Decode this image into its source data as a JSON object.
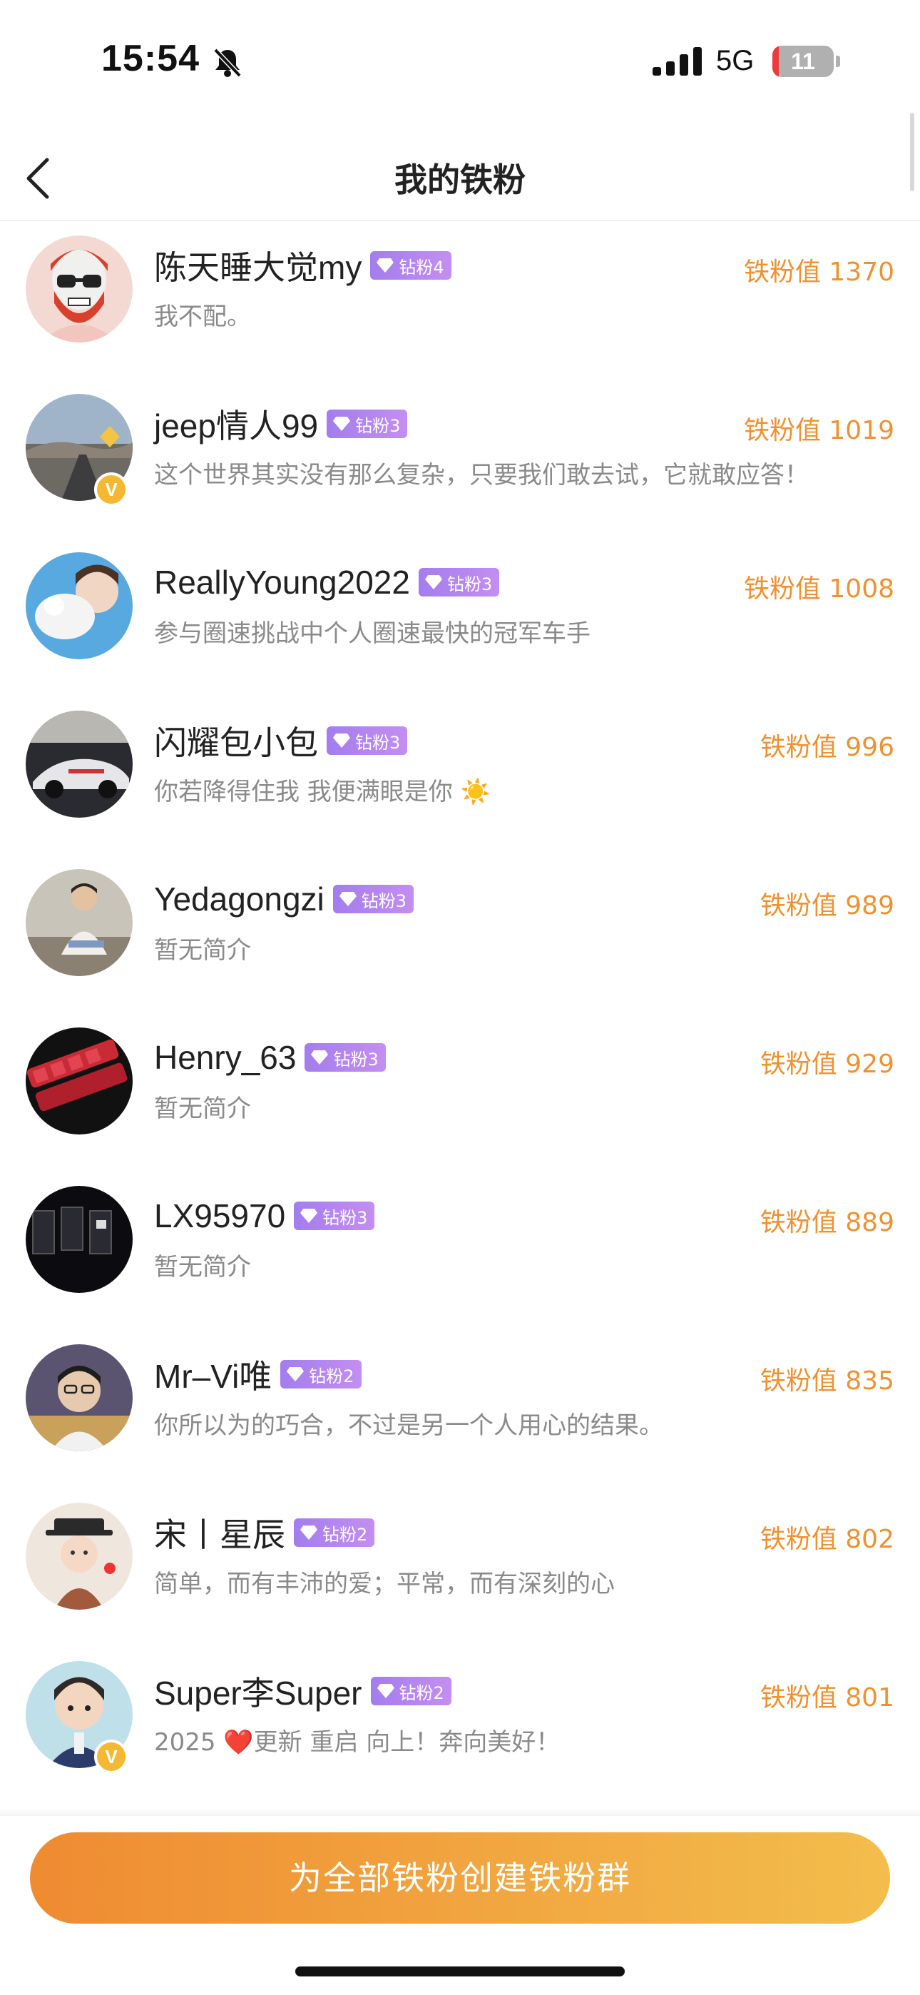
{
  "status_bar": {
    "time": "15:54",
    "network": "5G",
    "battery": "11",
    "battery_level": 0.11
  },
  "nav": {
    "title": "我的铁粉"
  },
  "fans": [
    {
      "name": "陈天睡大觉my",
      "tag": "钻粉4",
      "score": "铁粉值 1370",
      "bio": "我不配。",
      "verified": false
    },
    {
      "name": "jeep情人99",
      "tag": "钻粉3",
      "score": "铁粉值 1019",
      "bio": "这个世界其实没有那么复杂，只要我们敢去试，它就敢应答！",
      "verified": true
    },
    {
      "name": "ReallyYoung2022",
      "tag": "钻粉3",
      "score": "铁粉值 1008",
      "bio": "参与圈速挑战中个人圈速最快的冠军车手",
      "verified": false
    },
    {
      "name": "闪耀包小包",
      "tag": "钻粉3",
      "score": "铁粉值 996",
      "bio": "你若降得住我 我便满眼是你 ☀️",
      "verified": false
    },
    {
      "name": "Yedagongzi",
      "tag": "钻粉3",
      "score": "铁粉值 989",
      "bio": "暂无简介",
      "verified": false
    },
    {
      "name": "Henry_63",
      "tag": "钻粉3",
      "score": "铁粉值 929",
      "bio": "暂无简介",
      "verified": false
    },
    {
      "name": "LX95970",
      "tag": "钻粉3",
      "score": "铁粉值 889",
      "bio": "暂无简介",
      "verified": false
    },
    {
      "name": "Mr–Vi唯",
      "tag": "钻粉2",
      "score": "铁粉值 835",
      "bio": "你所以为的巧合，不过是另一个人用心的结果。",
      "verified": false
    },
    {
      "name": "宋丨星辰",
      "tag": "钻粉2",
      "score": "铁粉值 802",
      "bio": "简单，而有丰沛的爱；平常，而有深刻的心",
      "verified": false
    },
    {
      "name": "Super李Super",
      "tag": "钻粉2",
      "score": "铁粉值 801",
      "bio": "2025 ❤️更新 重启 向上！奔向美好！",
      "verified": true
    }
  ],
  "cta": {
    "label": "为全部铁粉创建铁粉群"
  },
  "colors": {
    "accent": "#f0912f",
    "tag": "#b285ef",
    "verified": "#f5b833"
  },
  "icons": {
    "back": "chevron-left-icon",
    "bell": "bell-slash-icon",
    "gem": "diamond-icon"
  }
}
